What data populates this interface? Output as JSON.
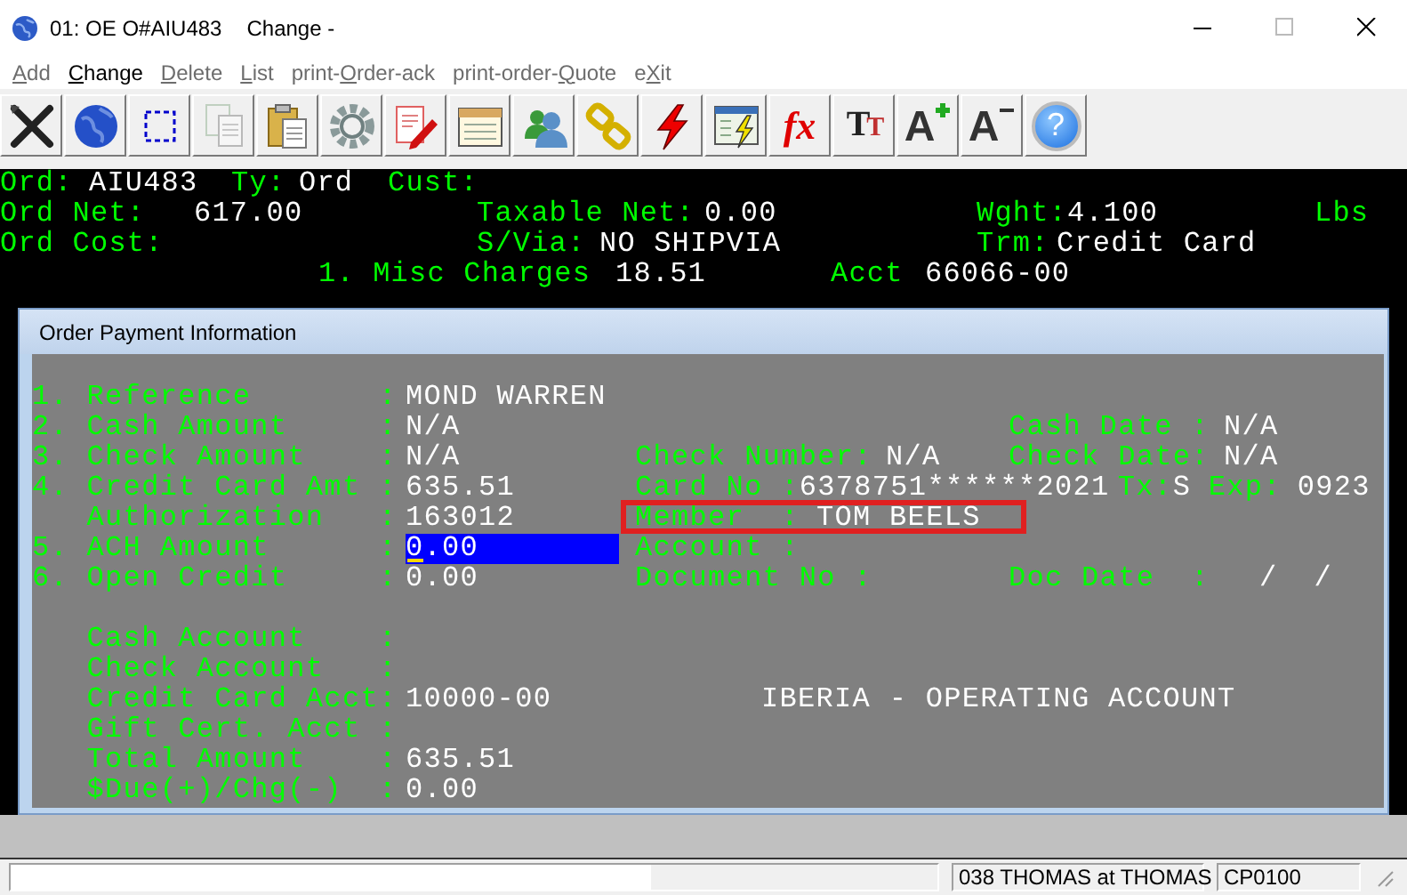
{
  "window": {
    "title": "01: OE O#AIU483",
    "mode": "Change -"
  },
  "menu": [
    {
      "label": "Add",
      "disabled": true
    },
    {
      "label": "Change",
      "disabled": false
    },
    {
      "label": "Delete",
      "disabled": true
    },
    {
      "label": "List",
      "disabled": true
    },
    {
      "label": "print-Order-ack",
      "disabled": true
    },
    {
      "label": "print-order-Quote",
      "disabled": true
    },
    {
      "label": "eXit",
      "disabled": true
    }
  ],
  "toolbar": [
    {
      "kind": "tools",
      "disabled": false
    },
    {
      "kind": "globe",
      "disabled": false
    },
    {
      "kind": "select",
      "disabled": false
    },
    {
      "kind": "copy",
      "disabled": true
    },
    {
      "kind": "paste",
      "disabled": false
    },
    {
      "kind": "gear",
      "disabled": false
    },
    {
      "kind": "edit",
      "disabled": false
    },
    {
      "kind": "notepad",
      "disabled": false
    },
    {
      "kind": "users",
      "disabled": false
    },
    {
      "kind": "link",
      "disabled": false
    },
    {
      "kind": "lightning",
      "disabled": false
    },
    {
      "kind": "run",
      "disabled": false
    },
    {
      "kind": "formula",
      "text": "fx",
      "disabled": false
    },
    {
      "kind": "fonts",
      "text": "TT",
      "disabled": false
    },
    {
      "kind": "font-larger",
      "text": "A",
      "disabled": false
    },
    {
      "kind": "font-smaller",
      "text": "A",
      "disabled": false
    },
    {
      "kind": "help",
      "text": "?",
      "disabled": false
    }
  ],
  "order_header": {
    "rows": [
      {
        "items": [
          {
            "label": "Ord:",
            "value": "AIU483"
          },
          {
            "label": "Ty:",
            "value": "Ord"
          },
          {
            "label": "Cust:"
          }
        ]
      },
      {
        "items": [
          {
            "label": "Ord Net:",
            "value": "617.00"
          },
          {
            "label": "Taxable Net:",
            "value": "0.00"
          },
          {
            "label": "Wght:",
            "value": "4.100"
          },
          {
            "label": "Lbs"
          }
        ]
      },
      {
        "items": [
          {
            "label": "Ord Cost:"
          },
          {
            "label": "S/Via:",
            "value": "NO SHIPVIA"
          },
          {
            "label": "Trm:",
            "value": "Credit Card"
          }
        ]
      },
      {
        "items": [
          {
            "label": "1. Misc Charges",
            "value": "18.51"
          },
          {
            "label": "Acct",
            "value": "66066-00"
          }
        ]
      }
    ]
  },
  "dialog": {
    "title": "Order Payment Information",
    "rows": [
      {
        "items": [
          {
            "label": "1. Reference       :",
            "value": "MOND WARREN"
          }
        ]
      },
      {
        "items": [
          {
            "label": "2. Cash Amount     :",
            "value": "N/A"
          },
          {
            "label": "Cash Date :",
            "value": "N/A"
          }
        ]
      },
      {
        "items": [
          {
            "label": "3. Check Amount    :",
            "value": "N/A"
          },
          {
            "label": "Check Number:",
            "value": "N/A"
          },
          {
            "label": "Check Date:",
            "value": "N/A"
          }
        ]
      },
      {
        "items": [
          {
            "label": "4. Credit Card Amt :",
            "value": "635.51"
          },
          {
            "label": "Card No :",
            "value": "6378751******2021"
          },
          {
            "label": "Tx:",
            "value": "S"
          },
          {
            "label": "Exp:",
            "value": "0923"
          }
        ]
      },
      {
        "items": [
          {
            "label": "   Authorization   :",
            "value": "163012"
          },
          {
            "label": "Member  :",
            "value": "TOM BEELS",
            "highlighted": true
          }
        ]
      },
      {
        "items": [
          {
            "label": "5. ACH Amount      :",
            "value": "0.00",
            "focused": true
          },
          {
            "label": "Account :"
          }
        ]
      },
      {
        "items": [
          {
            "label": "6. Open Credit     :",
            "value": "0.00"
          },
          {
            "label": "Document No :"
          },
          {
            "label": "Doc Date  :",
            "value": "/  /"
          }
        ]
      },
      {
        "items": []
      },
      {
        "items": [
          {
            "label": "   Cash Account    :"
          }
        ]
      },
      {
        "items": [
          {
            "label": "   Check Account   :"
          }
        ]
      },
      {
        "items": [
          {
            "label": "   Credit Card Acct:",
            "value": "10000-00"
          },
          {
            "value": "IBERIA - OPERATING ACCOUNT"
          }
        ]
      },
      {
        "items": [
          {
            "label": "   Gift Cert. Acct :"
          }
        ]
      },
      {
        "items": [
          {
            "label": "   Total Amount    :",
            "value": "635.51"
          }
        ]
      },
      {
        "items": [
          {
            "label": "   $Due(+)/Chg(-)  :",
            "value": "0.00"
          }
        ]
      }
    ]
  },
  "status_bar": {
    "panels": [
      "038 THOMAS at THOMAS",
      "CP0100"
    ]
  }
}
